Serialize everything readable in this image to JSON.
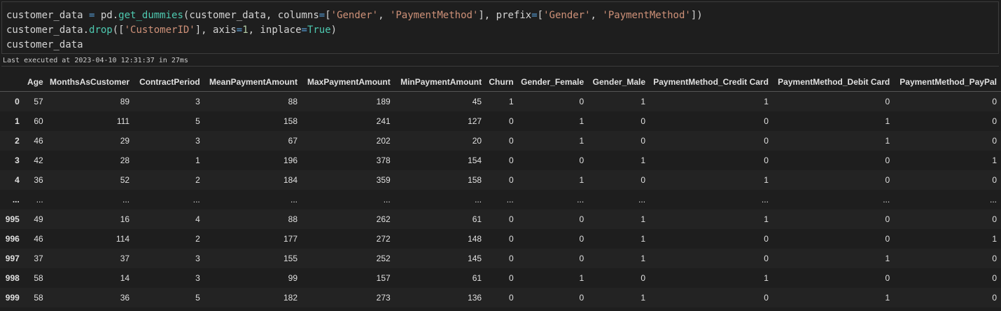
{
  "code": {
    "line1": [
      {
        "t": "customer_data ",
        "c": ""
      },
      {
        "t": "=",
        "c": "tok-kw"
      },
      {
        "t": " pd.",
        "c": ""
      },
      {
        "t": "get_dummies",
        "c": "tok-fn"
      },
      {
        "t": "(customer_data, columns",
        "c": ""
      },
      {
        "t": "=",
        "c": "tok-kw"
      },
      {
        "t": "[",
        "c": ""
      },
      {
        "t": "'Gender'",
        "c": "tok-str"
      },
      {
        "t": ", ",
        "c": ""
      },
      {
        "t": "'PaymentMethod'",
        "c": "tok-str"
      },
      {
        "t": "], prefix",
        "c": ""
      },
      {
        "t": "=",
        "c": "tok-kw"
      },
      {
        "t": "[",
        "c": ""
      },
      {
        "t": "'Gender'",
        "c": "tok-str"
      },
      {
        "t": ", ",
        "c": ""
      },
      {
        "t": "'PaymentMethod'",
        "c": "tok-str"
      },
      {
        "t": "])",
        "c": ""
      }
    ],
    "line2": [
      {
        "t": "customer_data.",
        "c": ""
      },
      {
        "t": "drop",
        "c": "tok-fn"
      },
      {
        "t": "([",
        "c": ""
      },
      {
        "t": "'CustomerID'",
        "c": "tok-str"
      },
      {
        "t": "], axis",
        "c": ""
      },
      {
        "t": "=",
        "c": "tok-kw"
      },
      {
        "t": "1",
        "c": "tok-num"
      },
      {
        "t": ", inplace",
        "c": ""
      },
      {
        "t": "=",
        "c": "tok-kw"
      },
      {
        "t": "True",
        "c": "tok-fn"
      },
      {
        "t": ")",
        "c": ""
      }
    ],
    "line3": [
      {
        "t": "customer_data",
        "c": ""
      }
    ]
  },
  "exec_status": "Last executed at 2023-04-10 12:31:37 in 27ms",
  "table": {
    "columns": [
      "",
      "Age",
      "MonthsAsCustomer",
      "ContractPeriod",
      "MeanPaymentAmount",
      "MaxPaymentAmount",
      "MinPaymentAmount",
      "Churn",
      "Gender_Female",
      "Gender_Male",
      "PaymentMethod_Credit Card",
      "PaymentMethod_Debit Card",
      "PaymentMethod_PayPal"
    ],
    "rows": [
      [
        "0",
        "57",
        "89",
        "3",
        "88",
        "189",
        "45",
        "1",
        "0",
        "1",
        "1",
        "0",
        "0"
      ],
      [
        "1",
        "60",
        "111",
        "5",
        "158",
        "241",
        "127",
        "0",
        "1",
        "0",
        "0",
        "1",
        "0"
      ],
      [
        "2",
        "46",
        "29",
        "3",
        "67",
        "202",
        "20",
        "0",
        "1",
        "0",
        "0",
        "1",
        "0"
      ],
      [
        "3",
        "42",
        "28",
        "1",
        "196",
        "378",
        "154",
        "0",
        "0",
        "1",
        "0",
        "0",
        "1"
      ],
      [
        "4",
        "36",
        "52",
        "2",
        "184",
        "359",
        "158",
        "0",
        "1",
        "0",
        "1",
        "0",
        "0"
      ],
      [
        "...",
        "...",
        "...",
        "...",
        "...",
        "...",
        "...",
        "...",
        "...",
        "...",
        "...",
        "...",
        "..."
      ],
      [
        "995",
        "49",
        "16",
        "4",
        "88",
        "262",
        "61",
        "0",
        "0",
        "1",
        "1",
        "0",
        "0"
      ],
      [
        "996",
        "46",
        "114",
        "2",
        "177",
        "272",
        "148",
        "0",
        "0",
        "1",
        "0",
        "0",
        "1"
      ],
      [
        "997",
        "37",
        "37",
        "3",
        "155",
        "252",
        "145",
        "0",
        "0",
        "1",
        "0",
        "1",
        "0"
      ],
      [
        "998",
        "58",
        "14",
        "3",
        "99",
        "157",
        "61",
        "0",
        "1",
        "0",
        "1",
        "0",
        "0"
      ],
      [
        "999",
        "58",
        "36",
        "5",
        "182",
        "273",
        "136",
        "0",
        "0",
        "1",
        "0",
        "1",
        "0"
      ]
    ]
  }
}
